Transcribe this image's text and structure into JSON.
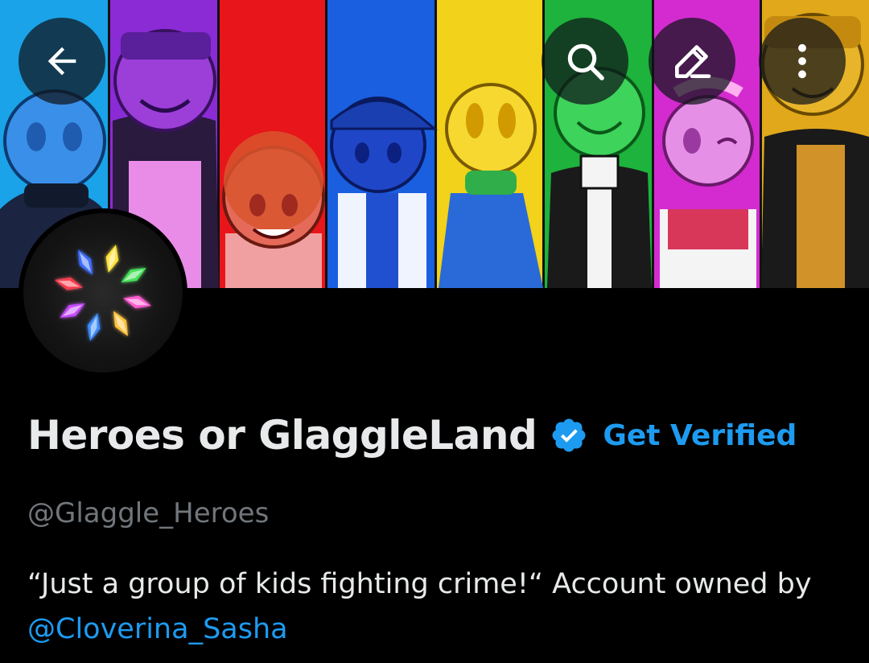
{
  "header": {
    "back_icon": "arrow-left-icon",
    "search_icon": "search-icon",
    "edit_icon": "pencil-icon",
    "more_icon": "more-vertical-icon"
  },
  "banner": {
    "stripe_colors": [
      "#1aa3e8",
      "#8a2bd6",
      "#e8151a",
      "#1a5fe0",
      "#f2d21a",
      "#1db33c",
      "#d42bd0",
      "#e0a81a"
    ]
  },
  "avatar": {
    "icon": "rainbow-gem-logo-icon"
  },
  "profile": {
    "display_name": "Heroes or GlaggleLand",
    "verified_icon": "verified-badge-icon",
    "get_verified_label": "Get Verified",
    "handle": "@Glaggle_Heroes",
    "bio_text": "“Just a group of kids fighting crime!“ Account owned by ",
    "bio_mention": "@Cloverina_Sasha"
  },
  "colors": {
    "accent": "#1d9bf0",
    "background": "#000000",
    "text_primary": "#e7e9ea",
    "text_secondary": "#71767b"
  }
}
